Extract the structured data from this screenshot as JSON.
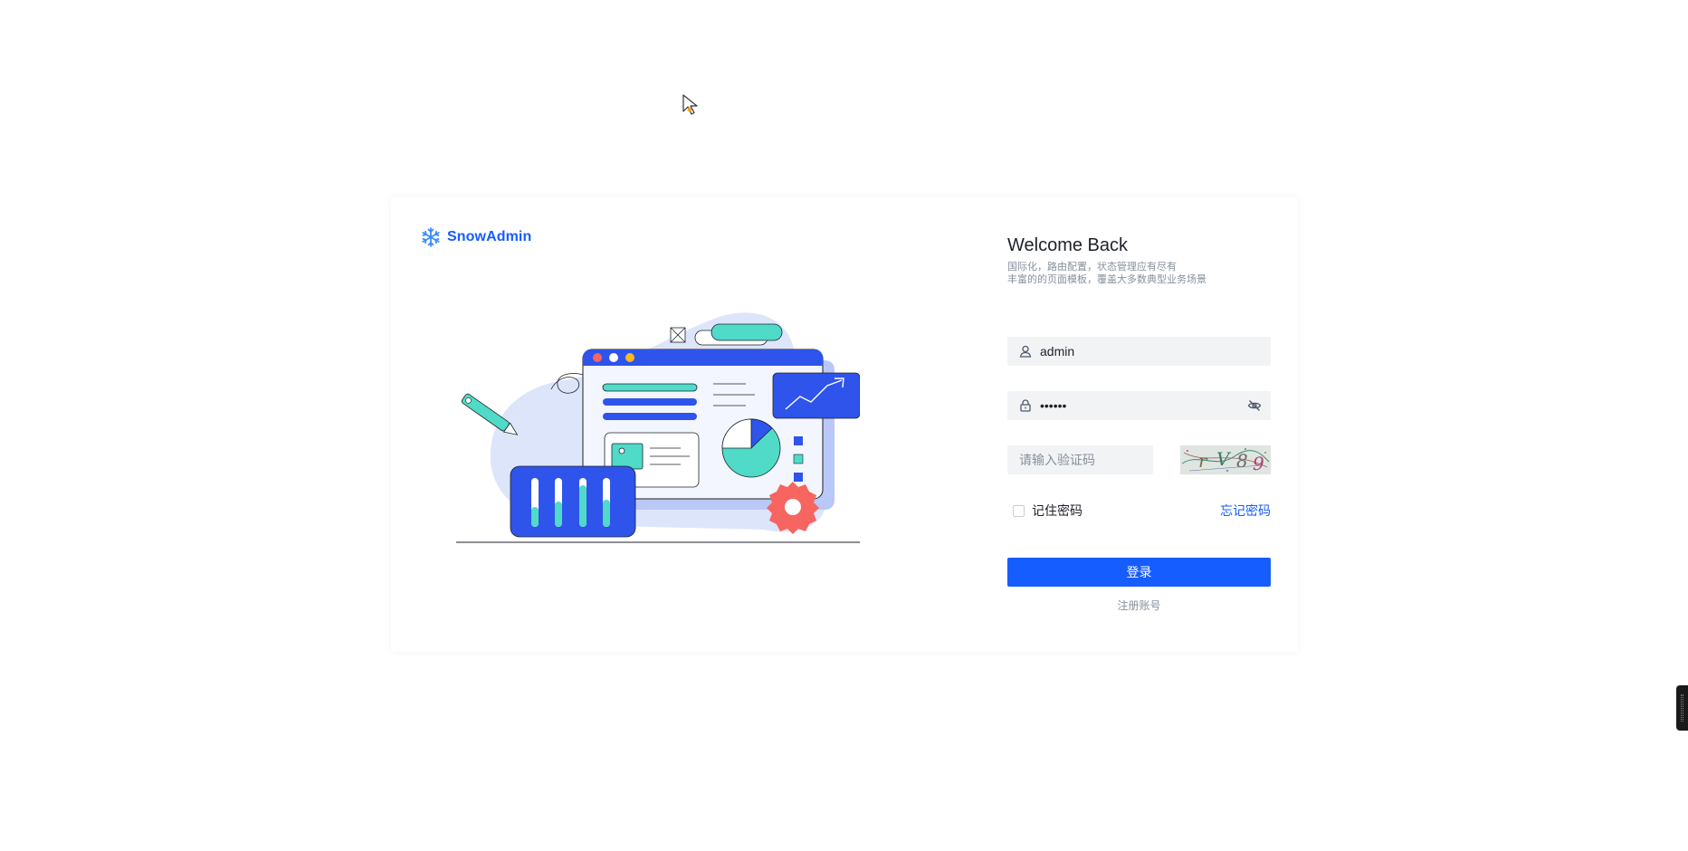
{
  "brand": {
    "name": "SnowAdmin"
  },
  "welcome": {
    "title": "Welcome Back",
    "subtitle_line1": "国际化，路由配置，状态管理应有尽有",
    "subtitle_line2": "丰富的的页面模板，覆盖大多数典型业务场景"
  },
  "login_form": {
    "username": {
      "value": "admin",
      "icon": "user-icon"
    },
    "password": {
      "value": "••••••",
      "icon": "lock-icon",
      "toggle_icon": "eye-invisible-icon"
    },
    "captcha": {
      "placeholder": "请输入验证码",
      "image_text": "rV89"
    },
    "remember_label": "记住密码",
    "forgot_label": "忘记密码",
    "submit_label": "登录",
    "register_label": "注册账号"
  },
  "colors": {
    "primary": "#165dff",
    "illustration_blue": "#2f54eb",
    "illustration_teal": "#4fdbc8",
    "illustration_red": "#f76560",
    "field_bg": "#f2f3f5"
  }
}
